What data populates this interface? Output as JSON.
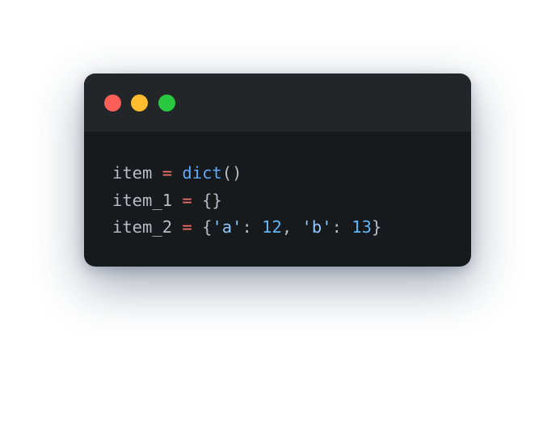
{
  "window": {
    "background": "#171a1c",
    "titlebar_background": "#232628",
    "controls": [
      {
        "name": "close",
        "color": "#fe5f57"
      },
      {
        "name": "minimize",
        "color": "#febc2e"
      },
      {
        "name": "zoom",
        "color": "#28c840"
      }
    ]
  },
  "colors": {
    "plain": "#b7bdc2",
    "operator": "#f07167",
    "function": "#5fa8f5",
    "string": "#8ec7ff",
    "number": "#64b5f6"
  },
  "code": {
    "lines": [
      [
        {
          "text": "item ",
          "kind": "plain"
        },
        {
          "text": "=",
          "kind": "operator"
        },
        {
          "text": " ",
          "kind": "plain"
        },
        {
          "text": "dict",
          "kind": "function"
        },
        {
          "text": "()",
          "kind": "plain"
        }
      ],
      [
        {
          "text": "item_1 ",
          "kind": "plain"
        },
        {
          "text": "=",
          "kind": "operator"
        },
        {
          "text": " {}",
          "kind": "plain"
        }
      ],
      [
        {
          "text": "item_2 ",
          "kind": "plain"
        },
        {
          "text": "=",
          "kind": "operator"
        },
        {
          "text": " {",
          "kind": "plain"
        },
        {
          "text": "'a'",
          "kind": "string"
        },
        {
          "text": ": ",
          "kind": "plain"
        },
        {
          "text": "12",
          "kind": "number"
        },
        {
          "text": ", ",
          "kind": "plain"
        },
        {
          "text": "'b'",
          "kind": "string"
        },
        {
          "text": ": ",
          "kind": "plain"
        },
        {
          "text": "13",
          "kind": "number"
        },
        {
          "text": "}",
          "kind": "plain"
        }
      ]
    ]
  }
}
